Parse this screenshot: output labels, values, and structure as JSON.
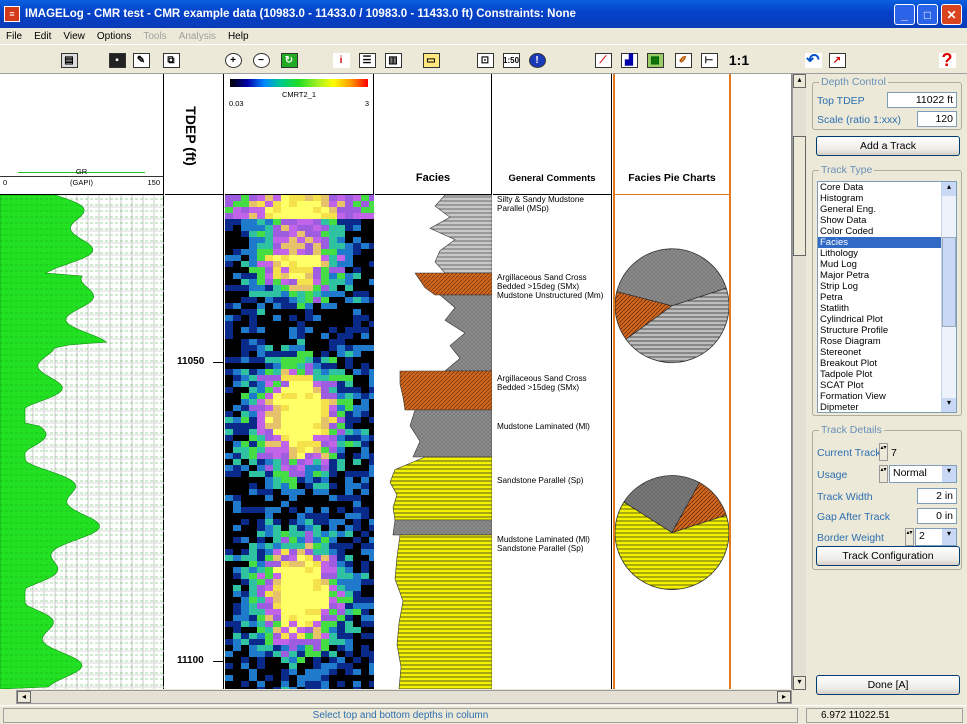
{
  "window": {
    "title": "IMAGELog - CMR test - CMR example data (10983.0 - 11433.0 / 10983.0 - 11433.0 ft) Constraints: None"
  },
  "menu": [
    {
      "label": "File",
      "enabled": true
    },
    {
      "label": "Edit",
      "enabled": true
    },
    {
      "label": "View",
      "enabled": true
    },
    {
      "label": "Options",
      "enabled": true
    },
    {
      "label": "Tools",
      "enabled": false
    },
    {
      "label": "Analysis",
      "enabled": false
    },
    {
      "label": "Help",
      "enabled": true
    }
  ],
  "toolbar": {
    "icons": [
      "print-icon",
      "save-icon",
      "edit-icon",
      "copy-icon",
      "zoom-in-icon",
      "zoom-out-icon",
      "refresh-icon",
      "info-well-icon",
      "header-icon",
      "grid-icon",
      "monitor-icon",
      "track-icon",
      "scale-1-50-icon",
      "about-icon",
      "crossplot-icon",
      "histogram-icon",
      "lithology-icon",
      "pencil-icon",
      "ruler-icon",
      "undo-icon",
      "export-icon",
      "help-icon"
    ],
    "scale_150": "1:50",
    "scale_11": "1:1"
  },
  "tracks": {
    "gr": {
      "name": "GR",
      "unit": "(GAPI)",
      "min": "0",
      "max": "150",
      "fill_color": "#22E022"
    },
    "depth": {
      "title": "TDEP (ft)",
      "labels": [
        {
          "text": "11050",
          "depth": 11050
        },
        {
          "text": "11100",
          "depth": 11100
        }
      ]
    },
    "image": {
      "name": "CMRT2_1",
      "min": "0.03",
      "max": "3"
    },
    "facies": {
      "title": "Facies"
    },
    "comments": {
      "title": "General Comments",
      "items": [
        {
          "text": "Silty & Sandy Mudstone Parallel (MSp)",
          "depth": 11023
        },
        {
          "text": "Argillaceous Sand Cross Bedded >15deg (SMx) Mudstone Unstructured (Mm)",
          "depth": 11036
        },
        {
          "text": "Argillaceous Sand Cross Bedded >15deg (SMx)",
          "depth": 11053
        },
        {
          "text": "Mudstone Laminated (Ml)",
          "depth": 11061
        },
        {
          "text": "Sandstone Parallel (Sp)",
          "depth": 11070
        },
        {
          "text": "Mudstone Laminated (Ml) Sandstone Parallel (Sp)",
          "depth": 11080
        }
      ]
    },
    "pie": {
      "title": "Facies Pie Charts"
    }
  },
  "pie_charts": [
    {
      "top_depth": 11031,
      "slices": [
        {
          "name": "Silty & Sandy Mudstone",
          "fraction": 0.45,
          "color": "#BDBDBD",
          "pattern": "hlines"
        },
        {
          "name": "Argillaceous Sand",
          "fraction": 0.14,
          "color": "#D2691E",
          "pattern": "diag"
        },
        {
          "name": "Mudstone",
          "fraction": 0.41,
          "color": "#8C8C8C",
          "pattern": "dots"
        }
      ]
    },
    {
      "top_depth": 11069,
      "slices": [
        {
          "name": "Sandstone",
          "fraction": 0.64,
          "color": "#F2F200",
          "pattern": "hlines"
        },
        {
          "name": "Mudstone",
          "fraction": 0.24,
          "color": "#7A7A7A",
          "pattern": "dots"
        },
        {
          "name": "Argillaceous Sand",
          "fraction": 0.12,
          "color": "#D2691E",
          "pattern": "diag"
        }
      ]
    }
  ],
  "depth_control": {
    "title": "Depth Control",
    "top_tdep_label": "Top TDEP",
    "top_tdep_value": "11022 ft",
    "scale_label": "Scale (ratio 1:xxx)",
    "scale_value": "120"
  },
  "add_track_label": "Add a Track",
  "track_type": {
    "title": "Track Type",
    "items": [
      "Core Data",
      "Histogram",
      "General Eng.",
      "Show Data",
      "Color Coded",
      "Facies",
      "Lithology",
      "Mud Log",
      "Major Petra",
      "Strip Log",
      "Petra",
      "Statlith",
      "Cylindrical Plot",
      "Structure Profile",
      "Rose Diagram",
      "Stereonet",
      "Breakout Plot",
      "Tadpole Plot",
      "SCAT Plot",
      "Formation View",
      "Dipmeter"
    ],
    "selected": "Facies"
  },
  "track_details": {
    "title": "Track Details",
    "current_track_label": "Current Track",
    "current_track_value": "7",
    "usage_label": "Usage",
    "usage_value": "Normal",
    "width_label": "Track Width",
    "width_value": "2 in",
    "gap_label": "Gap After Track",
    "gap_value": "0 in",
    "border_label": "Border Weight",
    "border_value": "2"
  },
  "track_config_label": "Track Configuration",
  "done_label": "Done [A]",
  "status": {
    "message": "Select top and bottom depths in column",
    "coords": "6.972 11022.51"
  }
}
